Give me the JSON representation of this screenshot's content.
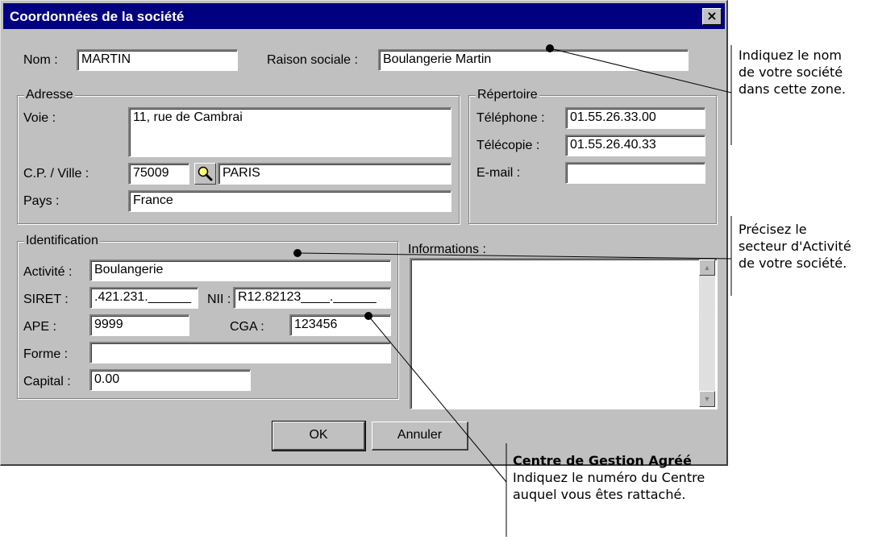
{
  "window": {
    "title": "Coordonnées de la société",
    "close_glyph": "×"
  },
  "company": {
    "nom_label": "Nom :",
    "nom_value": "MARTIN",
    "raison_label": "Raison sociale :",
    "raison_value": "Boulangerie Martin"
  },
  "adresse": {
    "title": "Adresse",
    "voie_label": "Voie :",
    "voie_value": "11, rue de Cambrai",
    "cpville_label": "C.P. / Ville :",
    "cp_value": "75009",
    "ville_value": "PARIS",
    "pays_label": "Pays :",
    "pays_value": "France"
  },
  "repertoire": {
    "title": "Répertoire",
    "telephone_label": "Téléphone :",
    "telephone_value": "01.55.26.33.00",
    "telecopie_label": "Télécopie :",
    "telecopie_value": "01.55.26.40.33",
    "email_label": "E-mail :",
    "email_value": ""
  },
  "identification": {
    "title": "Identification",
    "activite_label": "Activité :",
    "activite_value": "Boulangerie",
    "siret_label": "SIRET :",
    "siret_value": ".421.231.______",
    "nii_label": "NII :",
    "nii_value": "R12.82123____.______",
    "ape_label": "APE :",
    "ape_value": "9999",
    "cga_label": "CGA :",
    "cga_value": "123456",
    "forme_label": "Forme :",
    "forme_value": "",
    "capital_label": "Capital :",
    "capital_value": "0.00"
  },
  "informations": {
    "label": "Informations :",
    "value": ""
  },
  "buttons": {
    "ok": "OK",
    "cancel": "Annuler"
  },
  "icons": {
    "search": "magnifier-icon",
    "close": "close-icon",
    "scroll_up": "arrow-up-icon",
    "scroll_down": "arrow-down-icon"
  },
  "annotations": {
    "nom_note": [
      "Indiquez le nom",
      "de votre société",
      "dans cette zone."
    ],
    "activite_note": [
      "Précisez le",
      "secteur d'Activité",
      "de votre société."
    ],
    "cga_note_title": "Centre de Gestion Agréé",
    "cga_note": [
      "Indiquez le numéro du Centre",
      "auquel vous êtes rattaché."
    ]
  },
  "colors": {
    "titlebar": "#000080",
    "dialog": "#c0c0c0"
  }
}
